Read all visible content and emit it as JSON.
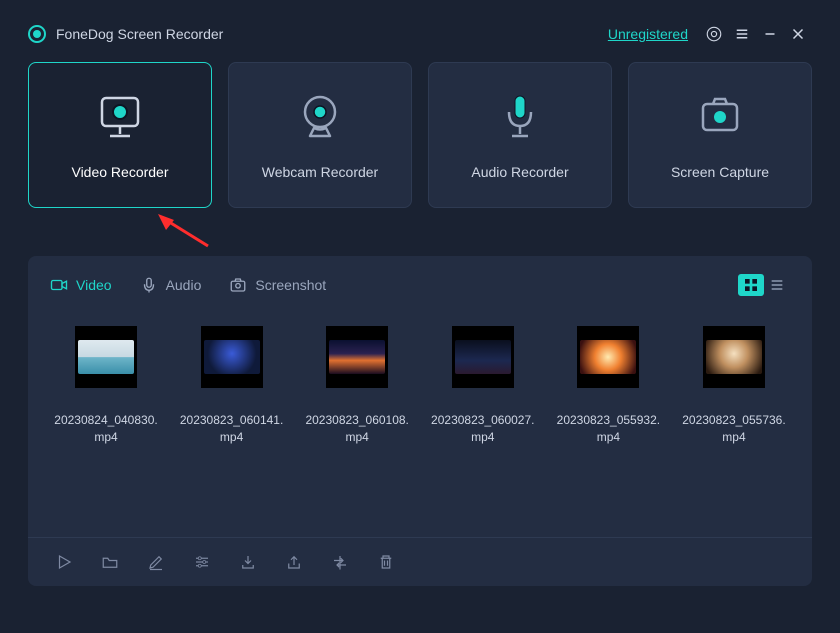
{
  "titlebar": {
    "app_name": "FoneDog Screen Recorder",
    "unregistered_label": "Unregistered"
  },
  "cards": [
    {
      "id": "video-recorder",
      "label": "Video Recorder",
      "active": true
    },
    {
      "id": "webcam-recorder",
      "label": "Webcam Recorder",
      "active": false
    },
    {
      "id": "audio-recorder",
      "label": "Audio Recorder",
      "active": false
    },
    {
      "id": "screen-capture",
      "label": "Screen Capture",
      "active": false
    }
  ],
  "tabs": {
    "video": "Video",
    "audio": "Audio",
    "screenshot": "Screenshot"
  },
  "files": [
    {
      "name": "20230824_040830.mp4",
      "thumb": "th1"
    },
    {
      "name": "20230823_060141.mp4",
      "thumb": "th2"
    },
    {
      "name": "20230823_060108.mp4",
      "thumb": "th3"
    },
    {
      "name": "20230823_060027.mp4",
      "thumb": "th4"
    },
    {
      "name": "20230823_055932.mp4",
      "thumb": "th5"
    },
    {
      "name": "20230823_055736.mp4",
      "thumb": "th6"
    }
  ],
  "colors": {
    "accent": "#1fd6c9",
    "bg": "#1a2232",
    "panel": "#232d42"
  }
}
